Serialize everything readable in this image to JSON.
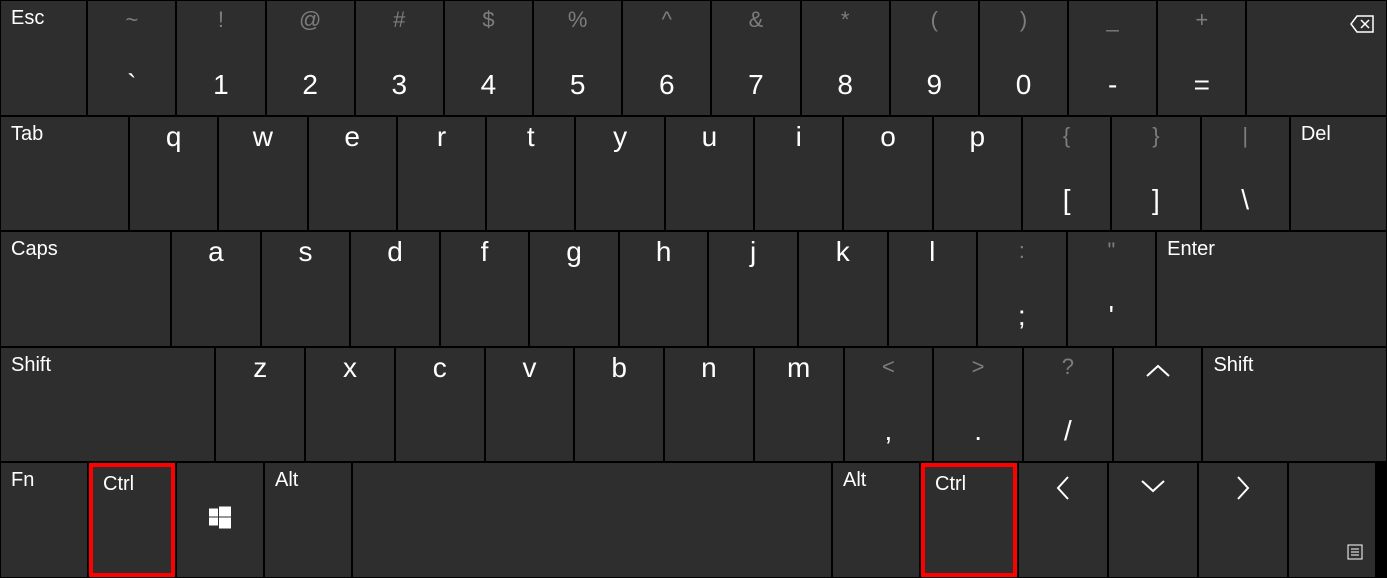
{
  "rows": [
    [
      {
        "name": "key-esc",
        "w": "unit-esc",
        "topLabel": "Esc"
      },
      {
        "name": "key-backtick",
        "w": "unit-1",
        "secondary": "~",
        "primary": "`"
      },
      {
        "name": "key-1",
        "w": "unit-1",
        "secondary": "!",
        "primary": "1"
      },
      {
        "name": "key-2",
        "w": "unit-1",
        "secondary": "@",
        "primary": "2"
      },
      {
        "name": "key-3",
        "w": "unit-1",
        "secondary": "#",
        "primary": "3"
      },
      {
        "name": "key-4",
        "w": "unit-1",
        "secondary": "$",
        "primary": "4"
      },
      {
        "name": "key-5",
        "w": "unit-1",
        "secondary": "%",
        "primary": "5"
      },
      {
        "name": "key-6",
        "w": "unit-1",
        "secondary": "^",
        "primary": "6"
      },
      {
        "name": "key-7",
        "w": "unit-1",
        "secondary": "&",
        "primary": "7"
      },
      {
        "name": "key-8",
        "w": "unit-1",
        "secondary": "*",
        "primary": "8"
      },
      {
        "name": "key-9",
        "w": "unit-1",
        "secondary": "(",
        "primary": "9"
      },
      {
        "name": "key-0",
        "w": "unit-1",
        "secondary": ")",
        "primary": "0"
      },
      {
        "name": "key-minus",
        "w": "unit-1",
        "secondary": "_",
        "primary": "-"
      },
      {
        "name": "key-equals",
        "w": "unit-1",
        "secondary": "+",
        "primary": "="
      },
      {
        "name": "key-backspace",
        "w": "unit-back",
        "icon": "backspace",
        "iconPos": "topRight"
      }
    ],
    [
      {
        "name": "key-tab",
        "w": "unit-tab",
        "topLabel": "Tab"
      },
      {
        "name": "key-q",
        "w": "unit-1",
        "letter": "q"
      },
      {
        "name": "key-w",
        "w": "unit-1",
        "letter": "w"
      },
      {
        "name": "key-e",
        "w": "unit-1",
        "letter": "e"
      },
      {
        "name": "key-r",
        "w": "unit-1",
        "letter": "r"
      },
      {
        "name": "key-t",
        "w": "unit-1",
        "letter": "t"
      },
      {
        "name": "key-y",
        "w": "unit-1",
        "letter": "y"
      },
      {
        "name": "key-u",
        "w": "unit-1",
        "letter": "u"
      },
      {
        "name": "key-i",
        "w": "unit-1",
        "letter": "i"
      },
      {
        "name": "key-o",
        "w": "unit-1",
        "letter": "o"
      },
      {
        "name": "key-p",
        "w": "unit-1",
        "letter": "p"
      },
      {
        "name": "key-left-bracket",
        "w": "unit-1",
        "secondary": "{",
        "primary": "["
      },
      {
        "name": "key-right-bracket",
        "w": "unit-1",
        "secondary": "}",
        "primary": "]"
      },
      {
        "name": "key-backslash",
        "w": "unit-1",
        "secondary": "|",
        "primary": "\\"
      },
      {
        "name": "key-del",
        "w": "unit-del",
        "topLabel": "Del"
      }
    ],
    [
      {
        "name": "key-caps",
        "w": "unit-caps",
        "topLabel": "Caps"
      },
      {
        "name": "key-a",
        "w": "unit-1",
        "letter": "a"
      },
      {
        "name": "key-s",
        "w": "unit-1",
        "letter": "s"
      },
      {
        "name": "key-d",
        "w": "unit-1",
        "letter": "d"
      },
      {
        "name": "key-f",
        "w": "unit-1",
        "letter": "f"
      },
      {
        "name": "key-g",
        "w": "unit-1",
        "letter": "g"
      },
      {
        "name": "key-h",
        "w": "unit-1",
        "letter": "h"
      },
      {
        "name": "key-j",
        "w": "unit-1",
        "letter": "j"
      },
      {
        "name": "key-k",
        "w": "unit-1",
        "letter": "k"
      },
      {
        "name": "key-l",
        "w": "unit-1",
        "letter": "l"
      },
      {
        "name": "key-semicolon",
        "w": "unit-1",
        "secondary": ":",
        "primary": ";"
      },
      {
        "name": "key-quote",
        "w": "unit-1",
        "secondary": "\"",
        "primary": "'"
      },
      {
        "name": "key-enter",
        "w": "unit-enter",
        "topLabel": "Enter"
      }
    ],
    [
      {
        "name": "key-shift-left",
        "w": "unit-shift-l",
        "topLabel": "Shift"
      },
      {
        "name": "key-z",
        "w": "unit-1",
        "letter": "z"
      },
      {
        "name": "key-x",
        "w": "unit-1",
        "letter": "x"
      },
      {
        "name": "key-c",
        "w": "unit-1",
        "letter": "c"
      },
      {
        "name": "key-v",
        "w": "unit-1",
        "letter": "v"
      },
      {
        "name": "key-b",
        "w": "unit-1",
        "letter": "b"
      },
      {
        "name": "key-n",
        "w": "unit-1",
        "letter": "n"
      },
      {
        "name": "key-m",
        "w": "unit-1",
        "letter": "m"
      },
      {
        "name": "key-comma",
        "w": "unit-1",
        "secondary": "<",
        "primary": ","
      },
      {
        "name": "key-period",
        "w": "unit-1",
        "secondary": ">",
        "primary": "."
      },
      {
        "name": "key-slash",
        "w": "unit-1",
        "secondary": "?",
        "primary": "/"
      },
      {
        "name": "key-up",
        "w": "unit-1",
        "icon": "up",
        "iconPos": "topCenter"
      },
      {
        "name": "key-shift-right",
        "w": "unit-shift-r",
        "topLabel": "Shift"
      }
    ],
    [
      {
        "name": "key-fn",
        "w": "unit-fn",
        "topLabel": "Fn"
      },
      {
        "name": "key-ctrl-left",
        "w": "unit-ctrl-l",
        "topLabel": "Ctrl",
        "highlight": true
      },
      {
        "name": "key-win",
        "w": "unit-win",
        "icon": "windows",
        "iconPos": "center"
      },
      {
        "name": "key-alt-left",
        "w": "unit-alt",
        "topLabel": "Alt"
      },
      {
        "name": "key-space",
        "w": "unit-space"
      },
      {
        "name": "key-alt-right",
        "w": "unit-alt",
        "topLabel": "Alt"
      },
      {
        "name": "key-ctrl-right",
        "w": "unit-ctrl-r",
        "topLabel": "Ctrl",
        "highlight": true
      },
      {
        "name": "key-left",
        "w": "unit-arrow",
        "icon": "left",
        "iconPos": "topCenter"
      },
      {
        "name": "key-down",
        "w": "unit-arrow",
        "icon": "down",
        "iconPos": "topCenter"
      },
      {
        "name": "key-right",
        "w": "unit-arrow",
        "icon": "right",
        "iconPos": "topCenter"
      },
      {
        "name": "key-menu",
        "w": "unit-menu",
        "icon": "menu",
        "iconPos": "bottomRight"
      }
    ]
  ],
  "icons": {
    "backspace": "backspace-icon",
    "windows": "windows-icon",
    "up": "arrow-up-icon",
    "down": "arrow-down-icon",
    "left": "arrow-left-icon",
    "right": "arrow-right-icon",
    "menu": "menu-icon"
  }
}
